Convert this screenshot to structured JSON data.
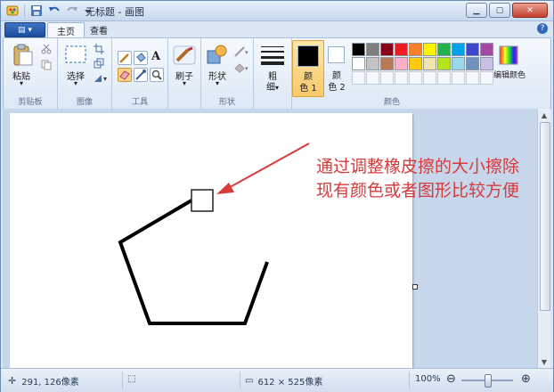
{
  "window": {
    "title": "无标题 - 画图"
  },
  "tabs": {
    "menu_button": "▤ ▾",
    "items": [
      {
        "label": "主页"
      },
      {
        "label": "查看"
      }
    ],
    "help": "?"
  },
  "ribbon": {
    "clipboard": {
      "paste_label": "粘贴",
      "group_label": "剪贴板"
    },
    "image": {
      "select_label": "选择",
      "group_label": "图像"
    },
    "tools": {
      "group_label": "工具"
    },
    "brushes": {
      "label": "刷子"
    },
    "shapes": {
      "label": "形状",
      "group_label": "形状"
    },
    "size": {
      "label_line1": "粗",
      "label_line2": "细"
    },
    "color1": {
      "label_line1": "颜",
      "label_line2": "色 1",
      "color": "#000000"
    },
    "color2": {
      "label_line1": "颜",
      "label_line2": "色 2",
      "color": "#ffffff"
    },
    "edit_colors": {
      "label": "编辑颜色"
    },
    "colors_group_label": "颜色",
    "palette_row1": [
      "#000000",
      "#7f7f7f",
      "#880015",
      "#ed1c24",
      "#ff7f27",
      "#fff200",
      "#22b14c",
      "#00a2e8",
      "#3f48cc",
      "#a349a4"
    ],
    "palette_row2": [
      "#ffffff",
      "#c3c3c3",
      "#b97a57",
      "#ffaec9",
      "#ffc90e",
      "#efe4b0",
      "#b5e61d",
      "#99d9ea",
      "#7092be",
      "#c8bfe7"
    ]
  },
  "annotation": {
    "line1": "通过调整橡皮擦的大小擦除",
    "line2": "现有颜色或者图形比较方便",
    "color": "#d8393a"
  },
  "statusbar": {
    "cursor_pos": "291, 126像素",
    "canvas_size": "612 × 525像素",
    "zoom": "100%"
  }
}
